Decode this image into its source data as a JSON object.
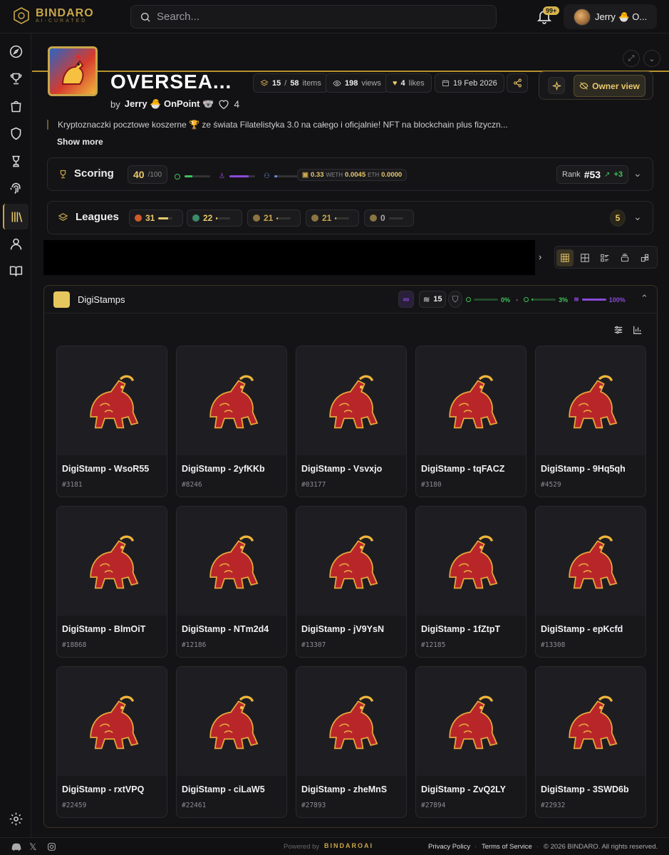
{
  "brand": {
    "name": "BINDARO",
    "tagline": "AI-CURATED"
  },
  "search": {
    "placeholder": "Search..."
  },
  "notifications": {
    "count": "99+"
  },
  "user": {
    "name": "Jerry 🐣 O..."
  },
  "collection": {
    "title": "OVERSEA...",
    "by_prefix": "by",
    "creator": "Jerry 🐣 OnPoint 🐨",
    "creator_likes": "4",
    "items_owned": "15",
    "items_sep": "/",
    "items_total": "58",
    "items_label": "items",
    "views": "198",
    "views_label": "views",
    "likes": "4",
    "likes_label": "likes",
    "date": "19 Feb 2026",
    "owner_view_label": "Owner view",
    "description": "Kryptoznaczki pocztowe koszerne 🏆 ze świata Filatelistyka 3.0 na całego i oficjalnie! NFT na blockchain plus fizyczn...",
    "show_more": "Show more"
  },
  "scoring": {
    "title": "Scoring",
    "score": "40",
    "score_max": "/100",
    "weth_value": "0.33",
    "weth_label": "WETH",
    "eth_value": "0.0045",
    "eth_label": "ETH",
    "other_value": "0.0000",
    "rank_label": "Rank",
    "rank": "#53",
    "rank_change": "+3",
    "bar1_fill": 0.3,
    "bar2_fill": 0.75,
    "bar3_fill": 0.1
  },
  "leagues": {
    "title": "Leagues",
    "items": [
      {
        "value": "31",
        "fill": 0.7
      },
      {
        "value": "22",
        "fill": 0.1
      },
      {
        "value": "21",
        "fill": 0.1
      },
      {
        "value": "21",
        "fill": 0.1
      },
      {
        "value": "0",
        "fill": 0.0
      }
    ],
    "count": "5"
  },
  "digistamps": {
    "name": "DigiStamps",
    "count": "15",
    "pct1": "0%",
    "pct2": "3%",
    "pct3": "100%"
  },
  "cards": [
    {
      "name": "DigiStamp - WsoR55",
      "id": "#3181",
      "icon": "horse-icon"
    },
    {
      "name": "DigiStamp - 2yfKKb",
      "id": "#8246",
      "icon": "rat-icon"
    },
    {
      "name": "DigiStamp - Vsvxjo",
      "id": "#03177",
      "icon": "ox-icon"
    },
    {
      "name": "DigiStamp - tqFACZ",
      "id": "#3180",
      "icon": "rabbit-icon"
    },
    {
      "name": "DigiStamp - 9Hq5qh",
      "id": "#4529",
      "icon": "tiger-icon"
    },
    {
      "name": "DigiStamp - BlmOiT",
      "id": "#18868",
      "icon": "horse-icon"
    },
    {
      "name": "DigiStamp - NTm2d4",
      "id": "#12186",
      "icon": "monkey-icon"
    },
    {
      "name": "DigiStamp - jV9YsN",
      "id": "#13307",
      "icon": "rooster-icon"
    },
    {
      "name": "DigiStamp - 1fZtpT",
      "id": "#12185",
      "icon": "dog-icon"
    },
    {
      "name": "DigiStamp - epKcfd",
      "id": "#13308",
      "icon": "dragon-icon"
    },
    {
      "name": "DigiStamp - rxtVPQ",
      "id": "#22459",
      "icon": "horse-icon"
    },
    {
      "name": "DigiStamp - ciLaW5",
      "id": "#22461",
      "icon": "snake-icon"
    },
    {
      "name": "DigiStamp - zheMnS",
      "id": "#27893",
      "icon": "goat-icon"
    },
    {
      "name": "DigiStamp - ZvQ2LY",
      "id": "#27894",
      "icon": "pig-icon"
    },
    {
      "name": "DigiStamp - 3SWD6b",
      "id": "#22932",
      "icon": "horse-icon"
    }
  ],
  "footer": {
    "powered_by": "Powered by",
    "brand": "BINDAROAI",
    "privacy": "Privacy Policy",
    "terms": "Terms of Service",
    "copyright": "© 2026 BINDARO. All rights reserved."
  },
  "colors": {
    "gold": "#c9a64a",
    "red": "#b8262a",
    "green": "#3ec25a",
    "purple": "#8a4ad8"
  }
}
